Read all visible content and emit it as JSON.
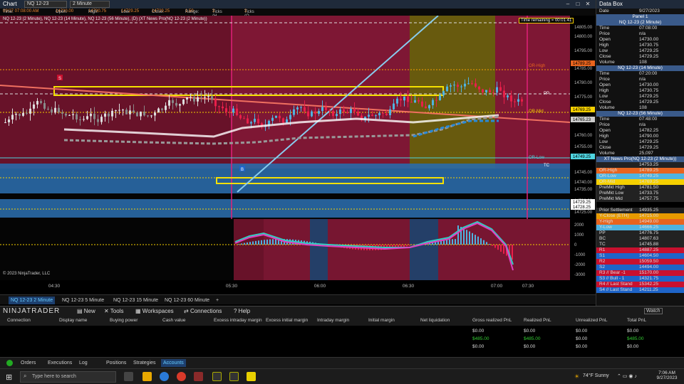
{
  "window": {
    "title": "Chart",
    "instrument": "NQ 12-23",
    "timeframe": "2 Minute",
    "databox_title": "Data Box"
  },
  "infobar": {
    "time_label": "Time:",
    "time_value": "09/27 07:08:00 AM",
    "open_label": "Open:",
    "open_value": "14730.00",
    "high_label": "High:",
    "high_value": "14730.75",
    "low_label": "Low:",
    "low_value": "14729.25",
    "close_label": "Close:",
    "close_value": "14729.25",
    "range_label": "Range:",
    "range_value": "1.50",
    "ticks_hl_label": "Ticks (H-O):",
    "ticks_hl_value": "3",
    "ticks_ol_label": "Ticks (O-L):",
    "ticks_ol_value": "3"
  },
  "chart": {
    "series_label": "NQ 12-23 (2 Minute), NQ 12-23 (14 Minute), NQ 12-23 (56 Minute), (D) (XT News Pro(NQ 12-23 (2 Minute))",
    "time_remaining": "Time remaining = 00:01:41",
    "copyright": "© 2023 NinjaTrader, LLC",
    "price_ticks": [
      "14805.00",
      "14800.00",
      "14795.00",
      "14785.00",
      "14780.00",
      "14775.00",
      "14770.00",
      "14765.00",
      "14760.00",
      "14755.00",
      "14745.00",
      "14740.00",
      "14735.00",
      "14730.00",
      "14725.00"
    ],
    "price_markers": [
      {
        "label": "14789.25",
        "color": "#e8641e"
      },
      {
        "label": "14769.25",
        "color": "#f5d000"
      },
      {
        "label": "14765.23",
        "color": "#cccccc"
      },
      {
        "label": "14749.25",
        "color": "#4fd4e0"
      },
      {
        "label": "14729.25",
        "color": "#ffffff"
      },
      {
        "label": "14728.25",
        "color": "#ffffff"
      }
    ],
    "level_labels": [
      "OR-High",
      "OR-Mid",
      "OR-Low",
      "PP",
      "TC"
    ],
    "signal_labels": [
      "S",
      "B"
    ],
    "osc_ticks": [
      "2000",
      "1000",
      "0",
      "-1000",
      "-2000",
      "-3000"
    ],
    "time_ticks": [
      "04:30",
      "05:30",
      "06:00",
      "06:30",
      "07:00",
      "07:30"
    ]
  },
  "tabs": [
    "NQ 12-23 2 Minute",
    "NQ 12-23 5 Minute",
    "NQ 12-23 15 Minute",
    "NQ 12-23 60 Minute"
  ],
  "tab_add": "+",
  "databox": {
    "date_label": "Date",
    "date_value": "9/27/2023",
    "panel_label": "Panel 1",
    "sections": [
      {
        "title": "NQ 12-23 (2 Minute)",
        "rows": [
          [
            "Time",
            "07:08:00"
          ],
          [
            "Price",
            "n/a"
          ],
          [
            "Open",
            "14730.00"
          ],
          [
            "High",
            "14730.75"
          ],
          [
            "Low",
            "14729.25"
          ],
          [
            "Close",
            "14729.25"
          ],
          [
            "Volume",
            "108"
          ]
        ]
      },
      {
        "title": "NQ 12-23 (14 Minute)",
        "rows": [
          [
            "Time",
            "07:20:00"
          ],
          [
            "Price",
            "n/a"
          ],
          [
            "Open",
            "14730.00"
          ],
          [
            "High",
            "14730.75"
          ],
          [
            "Low",
            "14729.25"
          ],
          [
            "Close",
            "14729.25"
          ],
          [
            "Volume",
            "108"
          ]
        ]
      },
      {
        "title": "NQ 12-23 (56 Minute)",
        "rows": [
          [
            "Time",
            "07:48:00"
          ],
          [
            "Price",
            "n/a"
          ],
          [
            "Open",
            "14782.25"
          ],
          [
            "High",
            "14790.00"
          ],
          [
            "Low",
            "14729.25"
          ],
          [
            "Close",
            "14729.25"
          ],
          [
            "Volume",
            "25,097"
          ]
        ]
      }
    ],
    "news_title": "XT News Pro(NQ 12-23 (2 Minute))",
    "levels": [
      [
        "",
        "14753.25",
        "#222"
      ],
      [
        "OR-High",
        "14789.25",
        "#e8641e"
      ],
      [
        "OR-Low",
        "14749.25",
        "#4fb3e0"
      ],
      [
        "OR-Mid",
        "14769.25",
        "#f5d000"
      ],
      [
        "PreMkt High",
        "14781.50",
        "#222"
      ],
      [
        "PreMkt Low",
        "14733.75",
        "#222"
      ],
      [
        "PreMkt Mid",
        "14757.75",
        "#222"
      ],
      [
        "",
        "",
        " #000"
      ],
      [
        "Prior Settlement",
        "14935.25",
        "#222"
      ],
      [
        "Y-Close (ETH)",
        "14715.00",
        "#e89a00"
      ],
      [
        "Y-High",
        "14949.00",
        "#e8641e"
      ],
      [
        "Y-Low",
        "14666.25",
        "#4fb3e0"
      ],
      [
        "PP",
        "14776.75",
        "#222"
      ],
      [
        "BC",
        "14807.63",
        "#222"
      ],
      [
        "TC",
        "14745.88",
        "#222"
      ],
      [
        "R1",
        "14887.25",
        "#c8102e"
      ],
      [
        "S1",
        "14604.50",
        "#1e64c8"
      ],
      [
        "R2",
        "15059.50",
        "#c8102e"
      ],
      [
        "S2",
        "14494.00",
        "#1e64c8"
      ],
      [
        "R3 // Bear -1",
        "15170.00",
        "#c8102e"
      ],
      [
        "S3 // Bull - 1",
        "14321.75",
        "#1e64c8"
      ],
      [
        "R4 // Last Stand",
        "15342.25",
        "#c8102e"
      ],
      [
        "S4 // Last Stand",
        "14211.25",
        "#1e64c8"
      ]
    ]
  },
  "ntbar": {
    "logo": "NINJATRADER",
    "menu": [
      "New",
      "Tools",
      "Workspaces",
      "Connections",
      "Help"
    ],
    "watch": "Watch"
  },
  "accounts": {
    "headers": [
      "Connection",
      "Display name",
      "Buying power",
      "Cash value",
      "Excess intraday margin",
      "Excess initial margin",
      "Intraday margin",
      "Initial margin",
      "Net liquidation",
      "Gross realized PnL",
      "Realized PnL",
      "Unrealized PnL",
      "Total PnL"
    ],
    "rows": [
      [
        "$0.00",
        "$0.00",
        "$0.00",
        "$0.00"
      ],
      [
        "$485.00",
        "$485.00",
        "$0.00",
        "$485.00"
      ],
      [
        "$0.00",
        "$0.00",
        "$0.00",
        "$0.00"
      ]
    ]
  },
  "bottom_tabs": [
    "Orders",
    "Executions",
    "Log",
    "Positions",
    "Strategies",
    "Accounts"
  ],
  "taskbar": {
    "search_placeholder": "Type here to search",
    "weather": "74°F  Sunny",
    "time": "7:06 AM",
    "date": "9/27/2023"
  }
}
